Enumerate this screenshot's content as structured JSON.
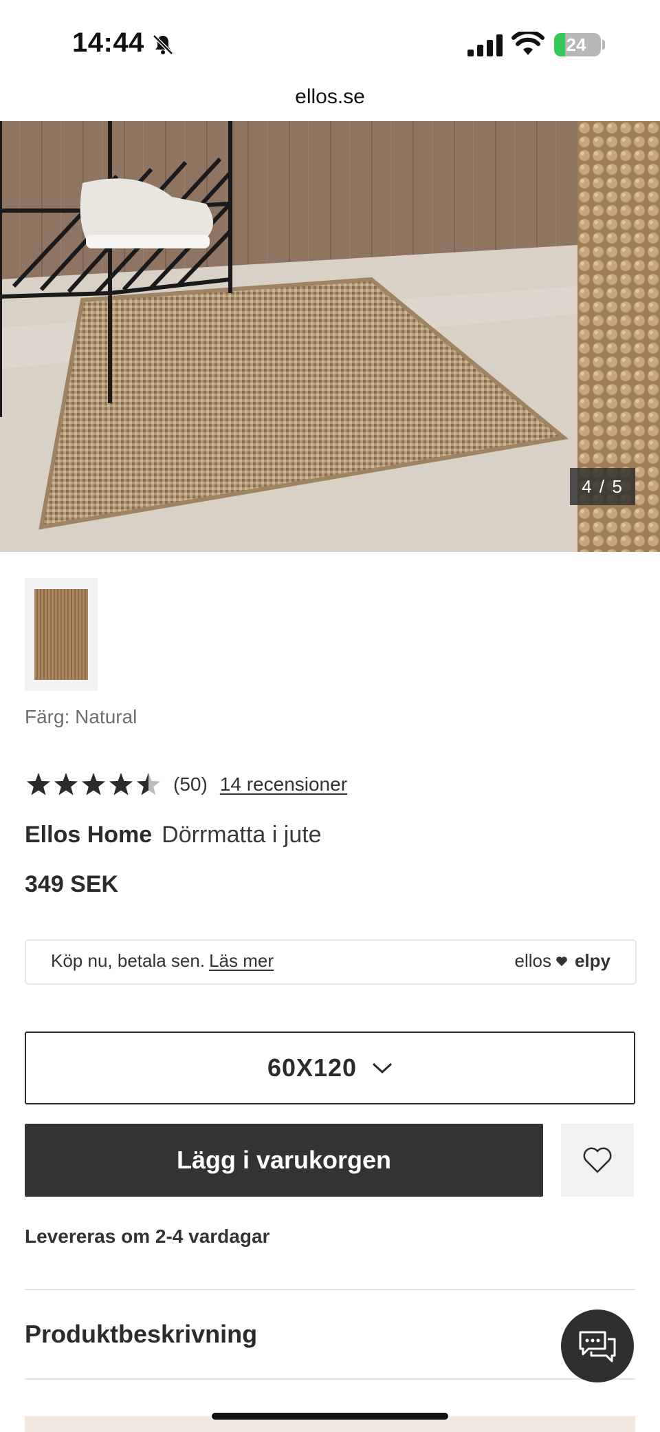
{
  "status_bar": {
    "time": "14:44",
    "battery": "24",
    "battery_level": 0.24
  },
  "browser": {
    "url": "ellos.se"
  },
  "gallery": {
    "counter": "4 / 5"
  },
  "product": {
    "color_label": "Färg: Natural",
    "rating": 4.5,
    "rating_count": "(50)",
    "reviews_link": "14 recensioner",
    "brand": "Ellos Home",
    "name": "Dörrmatta i jute",
    "price": "349 SEK"
  },
  "pay_later": {
    "text": "Köp nu, betala sen.",
    "link": "Läs mer",
    "logo_left": "ellos",
    "logo_right": "elpy"
  },
  "size_select": {
    "value": "60X120"
  },
  "actions": {
    "add_to_cart": "Lägg i varukorgen"
  },
  "delivery": "Levereras om 2-4 vardagar",
  "sections": {
    "description_title": "Produktbeskrivning"
  },
  "icons": {
    "bell": "bell-slash-icon",
    "signal": "cellular-signal-icon",
    "wifi": "wifi-icon",
    "favorite": "heart-icon",
    "chat": "chat-bubbles-icon",
    "chevron": "chevron-down-icon"
  },
  "colors": {
    "primary_button": "#333333",
    "battery_green": "#34c759",
    "text": "#2b2b2b"
  }
}
